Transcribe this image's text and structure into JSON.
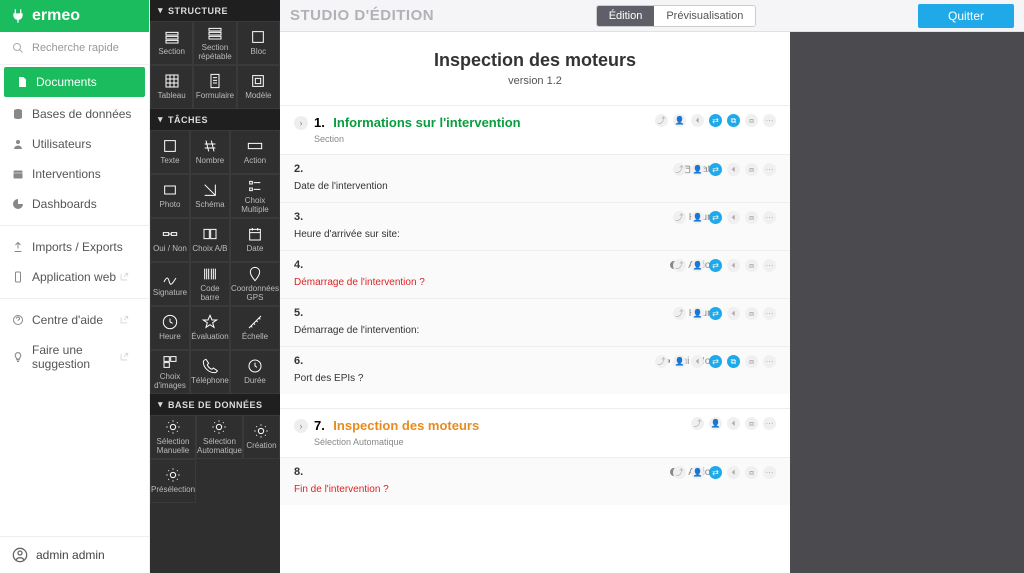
{
  "brand": "ermeo",
  "search_placeholder": "Recherche rapide",
  "nav": {
    "documents": "Documents",
    "databases": "Bases de données",
    "users": "Utilisateurs",
    "interventions": "Interventions",
    "dashboards": "Dashboards",
    "imports": "Imports / Exports",
    "webapp": "Application web",
    "help": "Centre d'aide",
    "suggest": "Faire une suggestion"
  },
  "footer_user": "admin admin",
  "topbar": {
    "studio": "STUDIO D'ÉDITION",
    "edit": "Édition",
    "preview": "Prévisualisation",
    "quit": "Quitter"
  },
  "panel": {
    "structure": "STRUCTURE",
    "structure_items": [
      "Section",
      "Section répétable",
      "Bloc",
      "Tableau",
      "Formulaire",
      "Modèle"
    ],
    "tasks": "TÂCHES",
    "task_items": [
      "Texte",
      "Nombre",
      "Action",
      "Photo",
      "Schéma",
      "Choix Multiple",
      "Oui / Non",
      "Choix A/B",
      "Date",
      "Signature",
      "Code barre",
      "Coordonnées GPS",
      "Heure",
      "Évaluation",
      "Échelle",
      "Choix d'images",
      "Téléphone",
      "Durée"
    ],
    "db": "BASE DE DONNÉES",
    "db_items": [
      "Sélection Manuelle",
      "Sélection Automatique",
      "Création",
      "Présélection"
    ]
  },
  "doc": {
    "title": "Inspection des moteurs",
    "version": "version 1.2",
    "section1_num": "1.",
    "section1_title": "Informations sur l'intervention",
    "section1_sub": "Section",
    "item2_num": "2.",
    "item2_type": "Date",
    "item2_label": "Date de l'intervention",
    "item3_num": "3.",
    "item3_type": "Heure",
    "item3_label": "Heure d'arrivée sur site:",
    "item4_num": "4.",
    "item4_type": "Action",
    "item4_label": "Démarrage de l'intervention ?",
    "item5_num": "5.",
    "item5_type": "Heure",
    "item5_label": "Démarrage de l'intervention:",
    "item6_num": "6.",
    "item6_type": "Oui / Non",
    "item6_label": "Port des EPIs ?",
    "section7_num": "7.",
    "section7_title": "Inspection des moteurs",
    "section7_sub": "Sélection Automatique",
    "item8_num": "8.",
    "item8_type": "Action",
    "item8_label": "Fin de l'intervention ?"
  }
}
